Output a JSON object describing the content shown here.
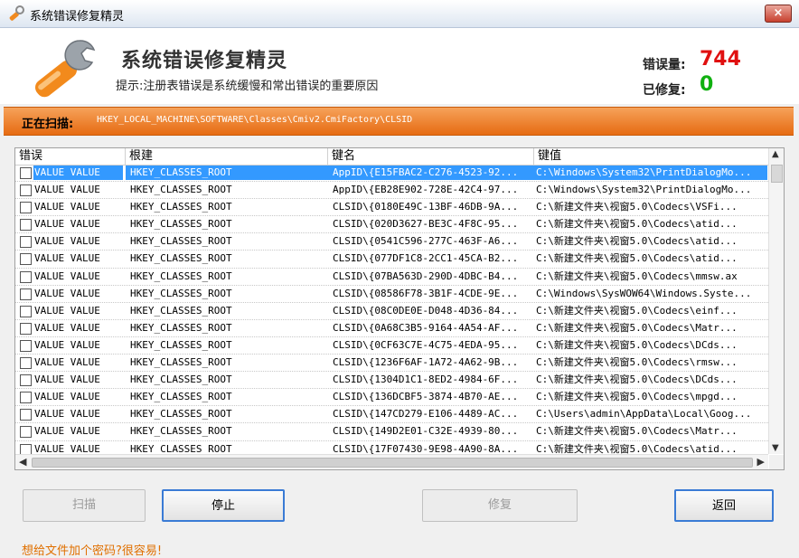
{
  "window": {
    "title": "系统错误修复精灵",
    "close_label": "×"
  },
  "header": {
    "app_title": "系统错误修复精灵",
    "hint": "提示:注册表错误是系统缓慢和常出错误的重要原因",
    "errors_label": "错误量:",
    "errors_value": "744",
    "fixed_label": "已修复:",
    "fixed_value": "0"
  },
  "scan": {
    "label": "正在扫描:",
    "path": "HKEY_LOCAL_MACHINE\\SOFTWARE\\Classes\\Cmiv2.CmiFactory\\CLSID"
  },
  "table": {
    "columns": [
      "错误",
      "根建",
      "键名",
      "键值"
    ],
    "rows": [
      {
        "err": "VALUE VALUE",
        "root": "HKEY_CLASSES_ROOT",
        "key": "AppID\\{E15FBAC2-C276-4523-92...",
        "val": "C:\\Windows\\System32\\PrintDialogMo...",
        "selected": true
      },
      {
        "err": "VALUE VALUE",
        "root": "HKEY_CLASSES_ROOT",
        "key": "AppID\\{EB28E902-728E-42C4-97...",
        "val": "C:\\Windows\\System32\\PrintDialogMo..."
      },
      {
        "err": "VALUE VALUE",
        "root": "HKEY_CLASSES_ROOT",
        "key": "CLSID\\{0180E49C-13BF-46DB-9A...",
        "val": "C:\\新建文件夹\\视窗5.0\\Codecs\\VSFi..."
      },
      {
        "err": "VALUE VALUE",
        "root": "HKEY_CLASSES_ROOT",
        "key": "CLSID\\{020D3627-BE3C-4F8C-95...",
        "val": "C:\\新建文件夹\\视窗5.0\\Codecs\\atid..."
      },
      {
        "err": "VALUE VALUE",
        "root": "HKEY_CLASSES_ROOT",
        "key": "CLSID\\{0541C596-277C-463F-A6...",
        "val": "C:\\新建文件夹\\视窗5.0\\Codecs\\atid..."
      },
      {
        "err": "VALUE VALUE",
        "root": "HKEY_CLASSES_ROOT",
        "key": "CLSID\\{077DF1C8-2CC1-45CA-B2...",
        "val": "C:\\新建文件夹\\视窗5.0\\Codecs\\atid..."
      },
      {
        "err": "VALUE VALUE",
        "root": "HKEY_CLASSES_ROOT",
        "key": "CLSID\\{07BA563D-290D-4DBC-B4...",
        "val": "C:\\新建文件夹\\视窗5.0\\Codecs\\mmsw.ax"
      },
      {
        "err": "VALUE VALUE",
        "root": "HKEY_CLASSES_ROOT",
        "key": "CLSID\\{08586F78-3B1F-4CDE-9E...",
        "val": "C:\\Windows\\SysWOW64\\Windows.Syste..."
      },
      {
        "err": "VALUE VALUE",
        "root": "HKEY_CLASSES_ROOT",
        "key": "CLSID\\{08C0DE0E-D048-4D36-84...",
        "val": "C:\\新建文件夹\\视窗5.0\\Codecs\\einf..."
      },
      {
        "err": "VALUE VALUE",
        "root": "HKEY_CLASSES_ROOT",
        "key": "CLSID\\{0A68C3B5-9164-4A54-AF...",
        "val": "C:\\新建文件夹\\视窗5.0\\Codecs\\Matr..."
      },
      {
        "err": "VALUE VALUE",
        "root": "HKEY_CLASSES_ROOT",
        "key": "CLSID\\{0CF63C7E-4C75-4EDA-95...",
        "val": "C:\\新建文件夹\\视窗5.0\\Codecs\\DCds..."
      },
      {
        "err": "VALUE VALUE",
        "root": "HKEY_CLASSES_ROOT",
        "key": "CLSID\\{1236F6AF-1A72-4A62-9B...",
        "val": "C:\\新建文件夹\\视窗5.0\\Codecs\\rmsw..."
      },
      {
        "err": "VALUE VALUE",
        "root": "HKEY_CLASSES_ROOT",
        "key": "CLSID\\{1304D1C1-8ED2-4984-6F...",
        "val": "C:\\新建文件夹\\视窗5.0\\Codecs\\DCds..."
      },
      {
        "err": "VALUE VALUE",
        "root": "HKEY_CLASSES_ROOT",
        "key": "CLSID\\{136DCBF5-3874-4B70-AE...",
        "val": "C:\\新建文件夹\\视窗5.0\\Codecs\\mpgd..."
      },
      {
        "err": "VALUE VALUE",
        "root": "HKEY_CLASSES_ROOT",
        "key": "CLSID\\{147CD279-E106-4489-AC...",
        "val": "C:\\Users\\admin\\AppData\\Local\\Goog..."
      },
      {
        "err": "VALUE VALUE",
        "root": "HKEY_CLASSES_ROOT",
        "key": "CLSID\\{149D2E01-C32E-4939-80...",
        "val": "C:\\新建文件夹\\视窗5.0\\Codecs\\Matr..."
      },
      {
        "err": "VALUE VALUE",
        "root": "HKEY_CLASSES_ROOT",
        "key": "CLSID\\{17F07430-9E98-4A90-8A...",
        "val": "C:\\新建文件夹\\视窗5.0\\Codecs\\atid..."
      }
    ]
  },
  "buttons": {
    "scan": "扫描",
    "stop": "停止",
    "repair": "修复",
    "back": "返回"
  },
  "footer": {
    "link": "想给文件加个密码?很容易!"
  },
  "icons": {
    "app": "wrench-icon",
    "logo": "wrench-logo-icon",
    "close": "close-icon",
    "up": "up-arrow-icon",
    "down": "down-arrow-icon",
    "left": "left-arrow-icon",
    "right": "right-arrow-icon"
  },
  "colors": {
    "accent_orange": "#e66b12",
    "error_red": "#e01010",
    "fixed_green": "#10b010",
    "selection": "#3399ff",
    "link_orange": "#e07000"
  }
}
